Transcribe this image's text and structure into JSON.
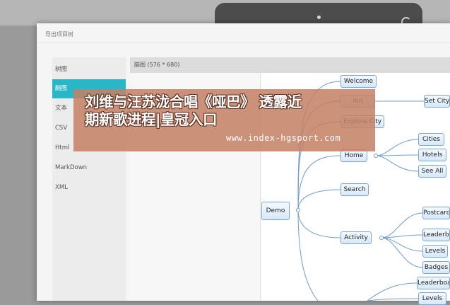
{
  "dialog": {
    "title": "导出项目树"
  },
  "nav": {
    "items": [
      {
        "label": "树图",
        "active": false
      },
      {
        "label": "脑图",
        "active": true
      },
      {
        "label": "文本",
        "active": false
      },
      {
        "label": "CSV",
        "active": false
      },
      {
        "label": "Html",
        "active": false
      },
      {
        "label": "MarkDown",
        "active": false
      },
      {
        "label": "XML",
        "active": false
      }
    ]
  },
  "preview": {
    "header": "脑图 (576 * 680)"
  },
  "mindmap": {
    "root": "Demo",
    "nodes": {
      "welcome": "Welcome",
      "ion": "ion",
      "explore_city": "Explore City",
      "home": "Home",
      "search": "Search",
      "activity": "Activity",
      "set_city": "Set City",
      "cities": "Cities",
      "hotels": "Hotels",
      "see_all": "See All",
      "postcard": "Postcard",
      "leaderboard": "Leaderbo",
      "levels": "Levels",
      "badges": "Badges",
      "leaderboard2": "Leaderboa",
      "levels2": "Levels"
    }
  },
  "banner": {
    "line1": "刘维与汪苏泷合唱《哑巴》 透露近",
    "line2": "期新歌进程|皇冠入口",
    "url": "www.index-hgsport.com"
  },
  "colors": {
    "accent": "#29b7c8",
    "node_border": "#7ba7d4",
    "connector": "#6f9ccc",
    "banner": "#c48064"
  }
}
